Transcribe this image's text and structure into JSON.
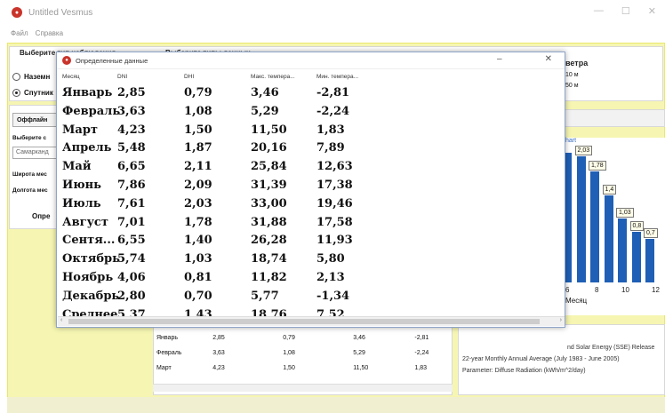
{
  "app": {
    "title": "Untitled Vesmus",
    "menu": [
      "Файл",
      "Справка"
    ]
  },
  "main": {
    "obs_type_header": "Выберите тип наблюдения",
    "data_type_header": "Выберите типы данных",
    "radio_ground": "Наземн",
    "radio_satellite": "Спутник",
    "offline_button": "Оффлайн",
    "select_label": "Выберите с",
    "city_value": "Самарканд",
    "lat_label": "Широта мес",
    "lon_label": "Долгота мес",
    "define_button": "Опре",
    "wind_header": "ветра",
    "wind_10": "10 м",
    "wind_50": "50 м",
    "chart_label": "hart",
    "chart_info_1": "nd Solar Energy (SSE) Release",
    "chart_info_2": "22-year Monthly  Annual Average (July 1983 - June 2005)",
    "chart_info_3": "Parameter: Diffuse Radiation (kWh/m^2/day)"
  },
  "chart_data": {
    "type": "bar",
    "categories": [
      "6",
      "8",
      "10",
      "12"
    ],
    "xlabel": "Месяц",
    "data_labels": [
      "2,03",
      "1,78",
      "1,4",
      "1,03",
      "0,8",
      "0,7"
    ],
    "values": [
      2.09,
      2.03,
      1.78,
      1.4,
      1.03,
      0.81,
      0.7
    ]
  },
  "bottom_table": {
    "rows": [
      {
        "month": "Январь",
        "dni": "2,85",
        "dhi": "0,79",
        "tmax": "3,46",
        "tmin": "-2,81"
      },
      {
        "month": "Февраль",
        "dni": "3,63",
        "dhi": "1,08",
        "tmax": "5,29",
        "tmin": "-2,24"
      },
      {
        "month": "Март",
        "dni": "4,23",
        "dhi": "1,50",
        "tmax": "11,50",
        "tmin": "1,83"
      }
    ]
  },
  "dialog": {
    "title": "Определенные данные",
    "minimize": "–",
    "close": "✕",
    "columns": [
      "Месяц",
      "DNI",
      "DHI",
      "Макс. темпера...",
      "Мин. темпера..."
    ],
    "rows": [
      [
        "Январь",
        "2,85",
        "0,79",
        "3,46",
        "-2,81"
      ],
      [
        "Февраль",
        "3,63",
        "1,08",
        "5,29",
        "-2,24"
      ],
      [
        "Март",
        "4,23",
        "1,50",
        "11,50",
        "1,83"
      ],
      [
        "Апрель",
        "5,48",
        "1,87",
        "20,16",
        "7,89"
      ],
      [
        "Май",
        "6,65",
        "2,11",
        "25,84",
        "12,63"
      ],
      [
        "Июнь",
        "7,86",
        "2,09",
        "31,39",
        "17,38"
      ],
      [
        "Июль",
        "7,61",
        "2,03",
        "33,00",
        "19,46"
      ],
      [
        "Август",
        "7,01",
        "1,78",
        "31,88",
        "17,58"
      ],
      [
        "Сентя...",
        "6,55",
        "1,40",
        "26,28",
        "11,93"
      ],
      [
        "Октябрь",
        "5,74",
        "1,03",
        "18,74",
        "5,80"
      ],
      [
        "Ноябрь",
        "4,06",
        "0,81",
        "11,82",
        "2,13"
      ],
      [
        "Декабрь",
        "2,80",
        "0,70",
        "5,77",
        "-1,34"
      ],
      [
        "Среднее",
        "5,37",
        "1,43",
        "18,76",
        "7,52"
      ]
    ]
  }
}
